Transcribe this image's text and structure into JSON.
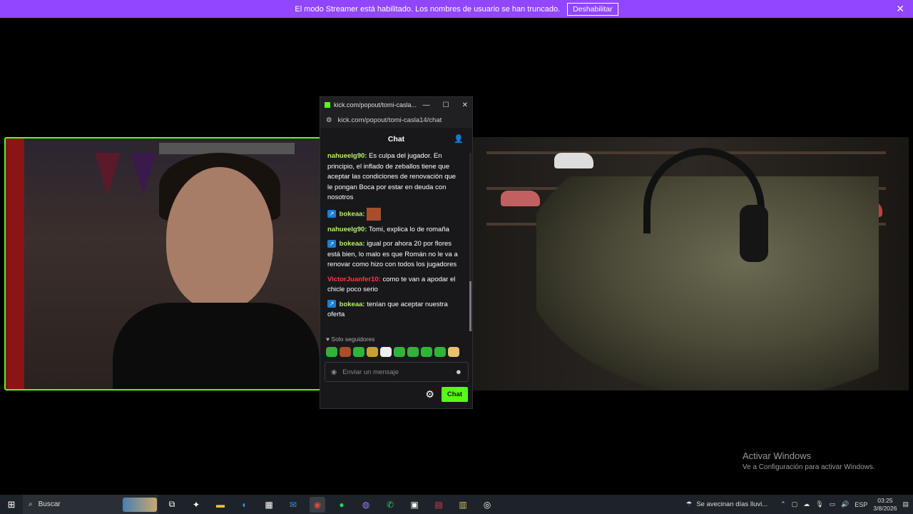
{
  "banner": {
    "message": "El modo Streamer está habilitado. Los nombres de usuario se han truncado.",
    "button": "Deshabilitar",
    "close": "✕"
  },
  "popup": {
    "window_title": "kick.com/popout/tomi-casla...",
    "url": "kick.com/popout/tomi-casla14/chat",
    "header": "Chat",
    "messages": [
      {
        "user": "nahueelg90:",
        "text": "Es culpa del jugador. En principio, el inflado de zeballos tiene que aceptar las condiciones de renovación que le pongan Boca por estar en deuda con nosotros",
        "color": "#b6f06a"
      },
      {
        "user": "bokeaa:",
        "text": "",
        "color": "#b6f06a",
        "badge": true,
        "emote": true
      },
      {
        "user": "nahueelg90:",
        "text": "Tomi, explica lo de romaña",
        "color": "#b6f06a"
      },
      {
        "user": "bokeaa:",
        "text": "igual por ahora 20 por flores está bien, lo malo es que Román no le va a renovar como hizo con todos los jugadores",
        "color": "#b6f06a",
        "badge": true
      },
      {
        "user": "VictorJuanfer10:",
        "text": "como te van a apodar el chicle poco serio",
        "color": "#ff3b3b"
      },
      {
        "user": "bokeaa:",
        "text": "tenían que aceptar nuestra oferta",
        "color": "#b6f06a",
        "badge": true
      }
    ],
    "followers_only": "Solo seguidores",
    "input_placeholder": "Enviar un mensaje",
    "chat_button": "Chat"
  },
  "watermark": {
    "title": "Activar Windows",
    "subtitle": "Ve a Configuración para activar Windows."
  },
  "taskbar": {
    "search": "Buscar",
    "weather": "Se avecinan días lluvi...",
    "language": "ESP",
    "time": "03:25",
    "date": "3/8/2026"
  }
}
